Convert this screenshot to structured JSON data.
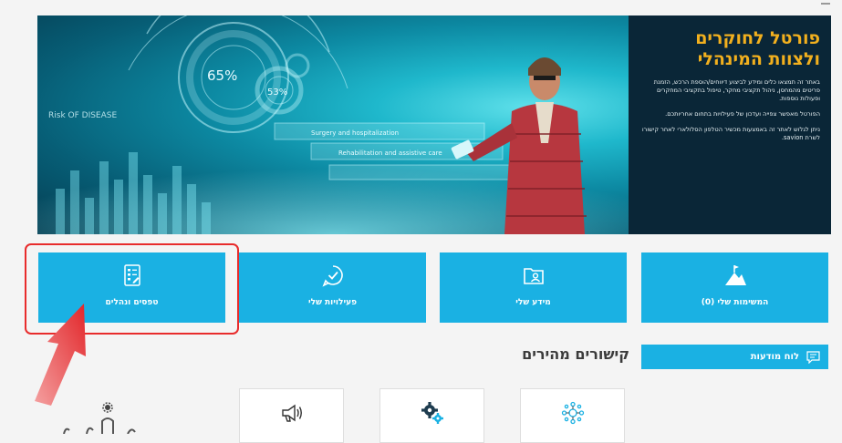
{
  "hero": {
    "title_line1": "פורטל לחוקרים",
    "title_line2": "ולצוות המינהלי",
    "paragraph1": "באתר זה תמצאו כלים ומידע לביצוע דיווחים/הוספת הרכש, הזמנת פריטים מהמחסן, ניהול תקציבי מחקר, טיפול בתקציבי המחקרים ופעולות נוספות.",
    "paragraph2": "הפורטל מאפשר צפייה ועדכון של פעילויות בתחום אחריותכם.",
    "paragraph3": "ניתן לגלוש לאתר זה באמצעות מכשיר הטלפון הסלולארי לאחר קישורו לשרת savion.",
    "image_texts": {
      "pct1": "65%",
      "pct2": "53%",
      "line_a": "Surgery and hospitalization",
      "line_b": "Rehabilitation and assistive care",
      "line_c": "Risk OF DISEASE"
    },
    "accent_color": "#f2b01e"
  },
  "tiles": [
    {
      "label": "המשימות שלי (0)",
      "icon": "mountain-flag-icon"
    },
    {
      "label": "מידע שלי",
      "icon": "folder-user-icon"
    },
    {
      "label": "פעילויות שלי",
      "icon": "chat-check-icon"
    },
    {
      "label": "טפסים ונהלים",
      "icon": "form-document-icon"
    }
  ],
  "messages_board": {
    "label": "לוח מודעות",
    "icon": "message-icon"
  },
  "quick_links": {
    "title": "קישורים מהירים",
    "items": [
      {
        "icon": "network-hub-icon"
      },
      {
        "icon": "gears-icon"
      },
      {
        "icon": "megaphone-icon"
      }
    ]
  },
  "colors": {
    "tile": "#1ab1e3",
    "highlight": "#e82c2c",
    "panel": "#0a2637"
  }
}
